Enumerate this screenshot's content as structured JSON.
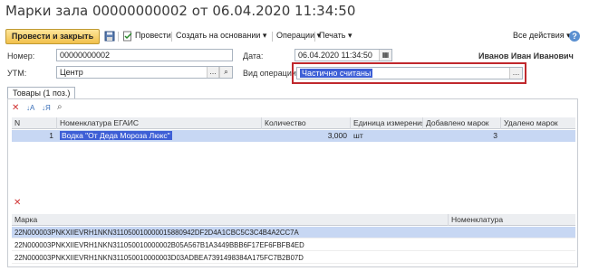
{
  "window": {
    "title": "Марки зала 00000000002 от 06.04.2020 11:34:50"
  },
  "toolbar": {
    "post_close_label": "Провести и закрыть",
    "save_icon": "save-icon",
    "post_label": "Провести",
    "create_based_label": "Создать на основании",
    "operations_label": "Операции",
    "print_label": "Печать",
    "all_actions_label": "Все действия",
    "help_label": "?"
  },
  "header": {
    "number_label": "Номер:",
    "number_value": "00000000002",
    "date_label": "Дата:",
    "date_value": "06.04.2020 11:34:50",
    "user_name": "Иванов Иван Иванович",
    "utm_label": "УТМ:",
    "utm_value": "Центр",
    "op_kind_label": "Вид операции:",
    "op_kind_value": "Частично считаны"
  },
  "tabs": [
    {
      "label": "Товары (1 поз.)"
    }
  ],
  "goods": {
    "columns": [
      "N",
      "Номенклатура ЕГАИС",
      "Количество",
      "Единица измерения",
      "Добавлено марок",
      "Удалено марок"
    ],
    "rows": [
      {
        "n": "1",
        "nomenclature": "Водка \"От Деда Мороза Люкс\"",
        "quantity": "3,000",
        "unit": "шт",
        "added": "3",
        "removed": ""
      }
    ]
  },
  "marks": {
    "columns": [
      "Марка",
      "Номенклатура"
    ],
    "rows": [
      {
        "mark": "22N000003PNKXIIEVRH1NKN311050010000015880942DF2D4A1CBC5C3C4B4A2CC7A",
        "nomenclature": ""
      },
      {
        "mark": "22N000003PNKXIIEVRH1NKN311050010000002B05A567B1A3449BBB6F17EF6FBFB4ED",
        "nomenclature": ""
      },
      {
        "mark": "22N000003PNKXIIEVRH1NKN311050010000003D03ADBEA7391498384A175FC7B2B07D",
        "nomenclature": ""
      }
    ]
  }
}
